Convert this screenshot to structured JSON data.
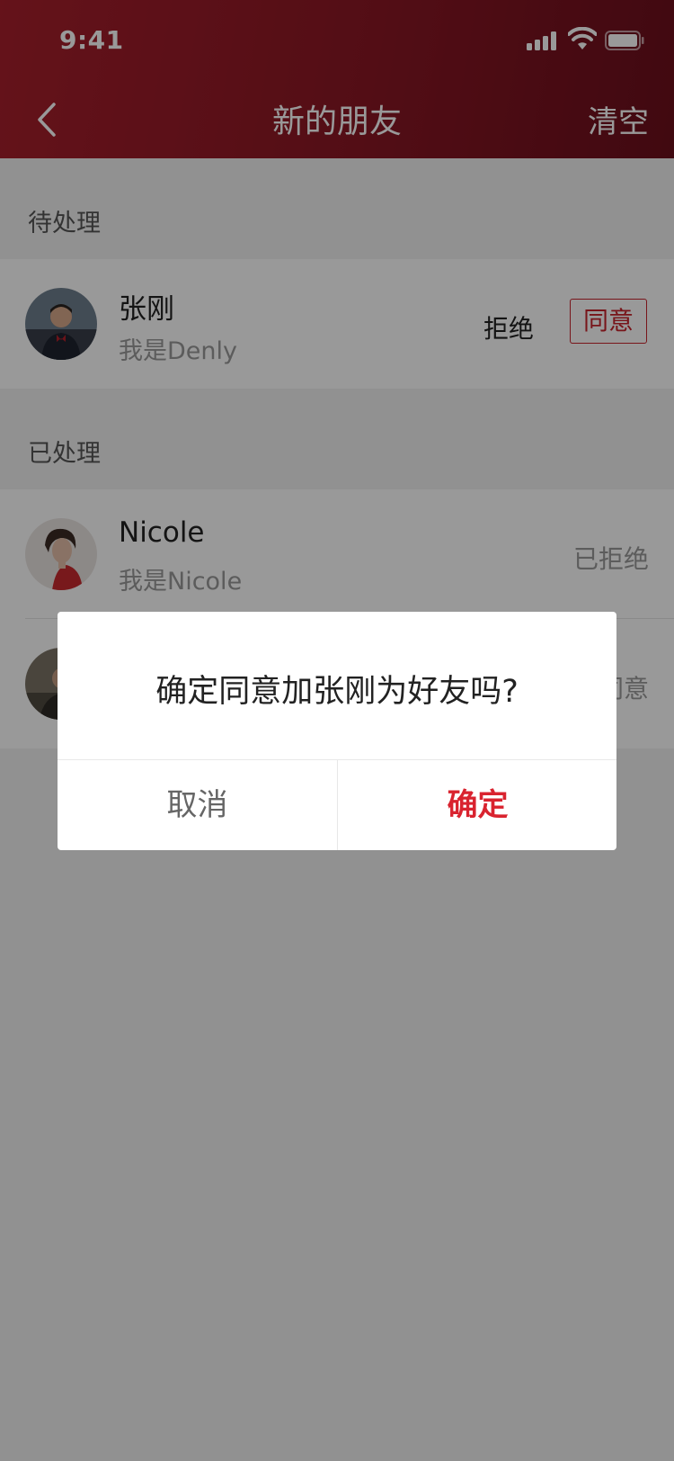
{
  "status_bar": {
    "time": "9:41"
  },
  "nav": {
    "title": "新的朋友",
    "right": "清空"
  },
  "pending": {
    "label": "待处理",
    "items": [
      {
        "name": "张刚",
        "desc": "我是Denly",
        "reject": "拒绝",
        "agree": "同意"
      }
    ]
  },
  "handled": {
    "label": "已处理",
    "items": [
      {
        "name": "Nicole",
        "desc": "我是Nicole",
        "status": "已拒绝"
      },
      {
        "name": "",
        "desc": "",
        "status": "已同意"
      }
    ]
  },
  "dialog": {
    "message": "确定同意加张刚为好友吗?",
    "cancel": "取消",
    "confirm": "确定"
  },
  "colors": {
    "accent": "#c8232c",
    "header_start": "#a81f2c",
    "header_end": "#6c0f1c",
    "overlay": "rgba(0,0,0,0.4)"
  }
}
